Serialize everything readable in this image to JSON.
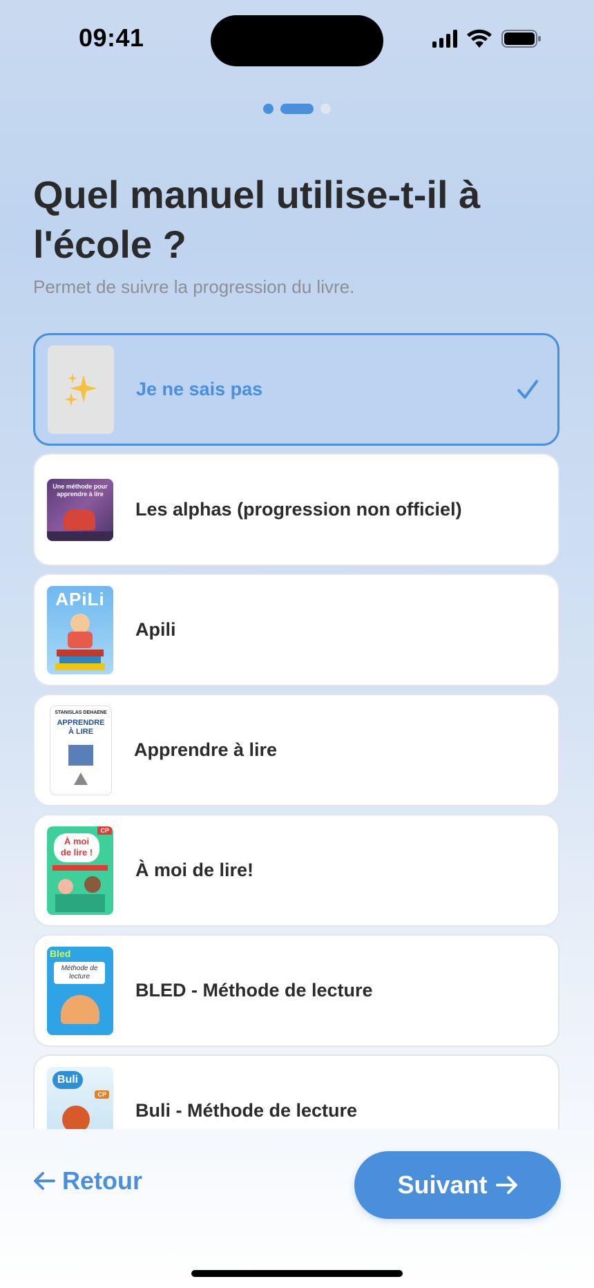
{
  "status_bar": {
    "time": "09:41"
  },
  "header": {
    "title": "Quel manuel utilise-t-il à l'école ?",
    "subtitle": "Permet de suivre la progression du livre."
  },
  "progress": {
    "total_steps": 3,
    "current_step": 2
  },
  "options": [
    {
      "label": "Je ne sais pas",
      "thumb": "sparkles-icon",
      "selected": true
    },
    {
      "label": "Les alphas (progression non officiel)",
      "thumb": "alphas-cover",
      "selected": false
    },
    {
      "label": "Apili",
      "thumb": "apili-cover",
      "selected": false
    },
    {
      "label": "Apprendre à lire",
      "thumb": "apprendre-a-lire-cover",
      "selected": false
    },
    {
      "label": "À moi de lire!",
      "thumb": "a-moi-de-lire-cover",
      "selected": false
    },
    {
      "label": "BLED - Méthode de lecture",
      "thumb": "bled-cover",
      "selected": false
    },
    {
      "label": "Buli - Méthode de lecture",
      "thumb": "buli-cover",
      "selected": false
    }
  ],
  "covers": {
    "alphas": {
      "title": "Une méthode pour apprendre à lire"
    },
    "apili": {
      "title": "APiLi"
    },
    "apprendre": {
      "author": "STANISLAS DEHAENE",
      "title1": "APPRENDRE",
      "title2": "À LIRE"
    },
    "amoi": {
      "badge": "CP",
      "title1": "À moi",
      "title2": "de lire !"
    },
    "bled": {
      "brand": "Bled",
      "title": "Méthode de lecture"
    },
    "buli": {
      "brand": "Buli",
      "badge": "CP"
    }
  },
  "footer": {
    "back_label": "Retour",
    "next_label": "Suivant"
  },
  "colors": {
    "accent": "#4a8fdb",
    "selected_bg": "#bcd3f1",
    "text": "#2b2b2b",
    "muted": "#8c8f96"
  }
}
